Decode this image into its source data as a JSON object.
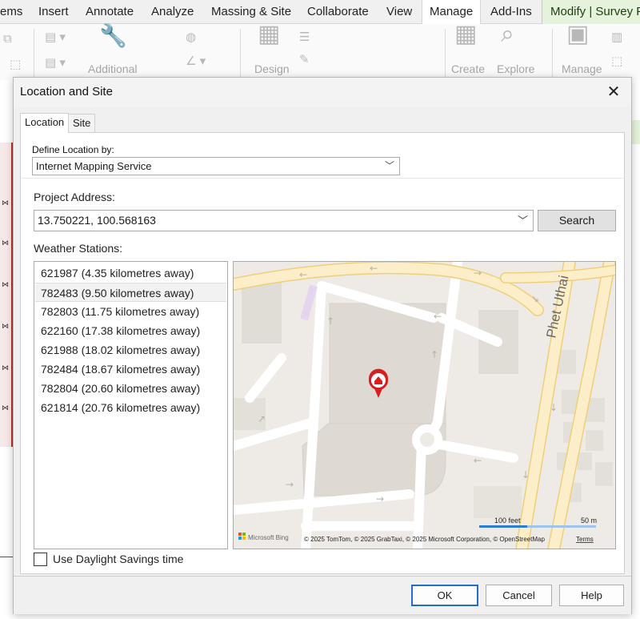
{
  "ribbon": {
    "tabs": [
      "ems",
      "Insert",
      "Annotate",
      "Analyze",
      "Massing & Site",
      "Collaborate",
      "View",
      "Manage",
      "Add-Ins",
      "Modify | Survey Po"
    ],
    "groups": {
      "additional": "Additional",
      "design": "Design",
      "create": "Create",
      "explore": "Explore",
      "manage": "Manage"
    },
    "active_tab": "Manage"
  },
  "dialog": {
    "title": "Location and Site",
    "tabs": [
      "Location",
      "Site"
    ],
    "define_location_label": "Define Location by:",
    "define_location_value": "Internet Mapping Service",
    "project_address_label": "Project Address:",
    "project_address_value": "13.750221, 100.568163",
    "search_label": "Search",
    "weather_label": "Weather Stations:",
    "stations": [
      "621987 (4.35 kilometres away)",
      "782483 (9.50 kilometres away)",
      "782803 (11.75 kilometres away)",
      "622160 (17.38 kilometres away)",
      "621988 (18.02 kilometres away)",
      "782484 (18.67 kilometres away)",
      "782804 (20.60 kilometres away)",
      "621814 (20.76 kilometres away)"
    ],
    "selected_station_index": 1,
    "daylight_label": "Use Daylight Savings time",
    "daylight_checked": false,
    "map": {
      "street_label": "Phet Uthai",
      "scale_feet": "100 feet",
      "scale_m": "50 m",
      "brand": "Microsoft Bing",
      "copyright": "© 2025 TomTom, © 2025 GrabTaxi, © 2025 Microsoft Corporation, © OpenStreetMap",
      "terms": "Terms"
    },
    "buttons": {
      "ok": "OK",
      "cancel": "Cancel",
      "help": "Help"
    }
  },
  "colors": {
    "accent": "#1f6fc8",
    "map_pin": "#d81e1e",
    "road_major": "#fbeec8",
    "road_outline": "#f0cf7a",
    "map_bg": "#eeebe6",
    "building": "#e0dcd6"
  }
}
